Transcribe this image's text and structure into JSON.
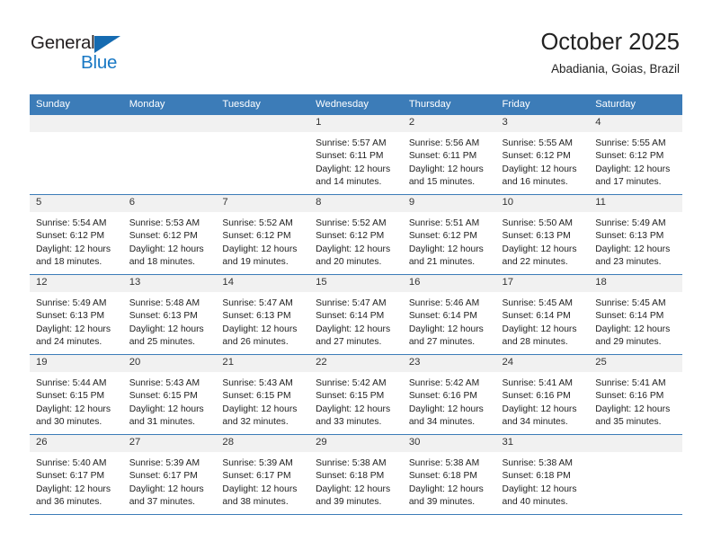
{
  "brand": {
    "name_top": "General",
    "name_bottom": "Blue",
    "triangle_color": "#156bb1",
    "blue_text_color": "#1878c4"
  },
  "header": {
    "title": "October 2025",
    "subtitle": "Abadiania, Goias, Brazil"
  },
  "theme": {
    "header_row_bg": "#3c7cb8",
    "header_row_text": "#ffffff",
    "daynum_bg": "#f1f1f1",
    "grid_line": "#3c7cb8"
  },
  "weekday_headers": [
    "Sunday",
    "Monday",
    "Tuesday",
    "Wednesday",
    "Thursday",
    "Friday",
    "Saturday"
  ],
  "labels": {
    "sunrise_prefix": "Sunrise:",
    "sunset_prefix": "Sunset:",
    "daylight_prefix": "Daylight:"
  },
  "weeks": [
    {
      "days": [
        {
          "day": "",
          "empty": true,
          "sunrise": "",
          "sunset": "",
          "daylight_line1": "",
          "daylight_line2": ""
        },
        {
          "day": "",
          "empty": true,
          "sunrise": "",
          "sunset": "",
          "daylight_line1": "",
          "daylight_line2": ""
        },
        {
          "day": "",
          "empty": true,
          "sunrise": "",
          "sunset": "",
          "daylight_line1": "",
          "daylight_line2": ""
        },
        {
          "day": "1",
          "empty": false,
          "sunrise": "Sunrise: 5:57 AM",
          "sunset": "Sunset: 6:11 PM",
          "daylight_line1": "Daylight: 12 hours",
          "daylight_line2": "and 14 minutes."
        },
        {
          "day": "2",
          "empty": false,
          "sunrise": "Sunrise: 5:56 AM",
          "sunset": "Sunset: 6:11 PM",
          "daylight_line1": "Daylight: 12 hours",
          "daylight_line2": "and 15 minutes."
        },
        {
          "day": "3",
          "empty": false,
          "sunrise": "Sunrise: 5:55 AM",
          "sunset": "Sunset: 6:12 PM",
          "daylight_line1": "Daylight: 12 hours",
          "daylight_line2": "and 16 minutes."
        },
        {
          "day": "4",
          "empty": false,
          "sunrise": "Sunrise: 5:55 AM",
          "sunset": "Sunset: 6:12 PM",
          "daylight_line1": "Daylight: 12 hours",
          "daylight_line2": "and 17 minutes."
        }
      ]
    },
    {
      "days": [
        {
          "day": "5",
          "empty": false,
          "sunrise": "Sunrise: 5:54 AM",
          "sunset": "Sunset: 6:12 PM",
          "daylight_line1": "Daylight: 12 hours",
          "daylight_line2": "and 18 minutes."
        },
        {
          "day": "6",
          "empty": false,
          "sunrise": "Sunrise: 5:53 AM",
          "sunset": "Sunset: 6:12 PM",
          "daylight_line1": "Daylight: 12 hours",
          "daylight_line2": "and 18 minutes."
        },
        {
          "day": "7",
          "empty": false,
          "sunrise": "Sunrise: 5:52 AM",
          "sunset": "Sunset: 6:12 PM",
          "daylight_line1": "Daylight: 12 hours",
          "daylight_line2": "and 19 minutes."
        },
        {
          "day": "8",
          "empty": false,
          "sunrise": "Sunrise: 5:52 AM",
          "sunset": "Sunset: 6:12 PM",
          "daylight_line1": "Daylight: 12 hours",
          "daylight_line2": "and 20 minutes."
        },
        {
          "day": "9",
          "empty": false,
          "sunrise": "Sunrise: 5:51 AM",
          "sunset": "Sunset: 6:12 PM",
          "daylight_line1": "Daylight: 12 hours",
          "daylight_line2": "and 21 minutes."
        },
        {
          "day": "10",
          "empty": false,
          "sunrise": "Sunrise: 5:50 AM",
          "sunset": "Sunset: 6:13 PM",
          "daylight_line1": "Daylight: 12 hours",
          "daylight_line2": "and 22 minutes."
        },
        {
          "day": "11",
          "empty": false,
          "sunrise": "Sunrise: 5:49 AM",
          "sunset": "Sunset: 6:13 PM",
          "daylight_line1": "Daylight: 12 hours",
          "daylight_line2": "and 23 minutes."
        }
      ]
    },
    {
      "days": [
        {
          "day": "12",
          "empty": false,
          "sunrise": "Sunrise: 5:49 AM",
          "sunset": "Sunset: 6:13 PM",
          "daylight_line1": "Daylight: 12 hours",
          "daylight_line2": "and 24 minutes."
        },
        {
          "day": "13",
          "empty": false,
          "sunrise": "Sunrise: 5:48 AM",
          "sunset": "Sunset: 6:13 PM",
          "daylight_line1": "Daylight: 12 hours",
          "daylight_line2": "and 25 minutes."
        },
        {
          "day": "14",
          "empty": false,
          "sunrise": "Sunrise: 5:47 AM",
          "sunset": "Sunset: 6:13 PM",
          "daylight_line1": "Daylight: 12 hours",
          "daylight_line2": "and 26 minutes."
        },
        {
          "day": "15",
          "empty": false,
          "sunrise": "Sunrise: 5:47 AM",
          "sunset": "Sunset: 6:14 PM",
          "daylight_line1": "Daylight: 12 hours",
          "daylight_line2": "and 27 minutes."
        },
        {
          "day": "16",
          "empty": false,
          "sunrise": "Sunrise: 5:46 AM",
          "sunset": "Sunset: 6:14 PM",
          "daylight_line1": "Daylight: 12 hours",
          "daylight_line2": "and 27 minutes."
        },
        {
          "day": "17",
          "empty": false,
          "sunrise": "Sunrise: 5:45 AM",
          "sunset": "Sunset: 6:14 PM",
          "daylight_line1": "Daylight: 12 hours",
          "daylight_line2": "and 28 minutes."
        },
        {
          "day": "18",
          "empty": false,
          "sunrise": "Sunrise: 5:45 AM",
          "sunset": "Sunset: 6:14 PM",
          "daylight_line1": "Daylight: 12 hours",
          "daylight_line2": "and 29 minutes."
        }
      ]
    },
    {
      "days": [
        {
          "day": "19",
          "empty": false,
          "sunrise": "Sunrise: 5:44 AM",
          "sunset": "Sunset: 6:15 PM",
          "daylight_line1": "Daylight: 12 hours",
          "daylight_line2": "and 30 minutes."
        },
        {
          "day": "20",
          "empty": false,
          "sunrise": "Sunrise: 5:43 AM",
          "sunset": "Sunset: 6:15 PM",
          "daylight_line1": "Daylight: 12 hours",
          "daylight_line2": "and 31 minutes."
        },
        {
          "day": "21",
          "empty": false,
          "sunrise": "Sunrise: 5:43 AM",
          "sunset": "Sunset: 6:15 PM",
          "daylight_line1": "Daylight: 12 hours",
          "daylight_line2": "and 32 minutes."
        },
        {
          "day": "22",
          "empty": false,
          "sunrise": "Sunrise: 5:42 AM",
          "sunset": "Sunset: 6:15 PM",
          "daylight_line1": "Daylight: 12 hours",
          "daylight_line2": "and 33 minutes."
        },
        {
          "day": "23",
          "empty": false,
          "sunrise": "Sunrise: 5:42 AM",
          "sunset": "Sunset: 6:16 PM",
          "daylight_line1": "Daylight: 12 hours",
          "daylight_line2": "and 34 minutes."
        },
        {
          "day": "24",
          "empty": false,
          "sunrise": "Sunrise: 5:41 AM",
          "sunset": "Sunset: 6:16 PM",
          "daylight_line1": "Daylight: 12 hours",
          "daylight_line2": "and 34 minutes."
        },
        {
          "day": "25",
          "empty": false,
          "sunrise": "Sunrise: 5:41 AM",
          "sunset": "Sunset: 6:16 PM",
          "daylight_line1": "Daylight: 12 hours",
          "daylight_line2": "and 35 minutes."
        }
      ]
    },
    {
      "days": [
        {
          "day": "26",
          "empty": false,
          "sunrise": "Sunrise: 5:40 AM",
          "sunset": "Sunset: 6:17 PM",
          "daylight_line1": "Daylight: 12 hours",
          "daylight_line2": "and 36 minutes."
        },
        {
          "day": "27",
          "empty": false,
          "sunrise": "Sunrise: 5:39 AM",
          "sunset": "Sunset: 6:17 PM",
          "daylight_line1": "Daylight: 12 hours",
          "daylight_line2": "and 37 minutes."
        },
        {
          "day": "28",
          "empty": false,
          "sunrise": "Sunrise: 5:39 AM",
          "sunset": "Sunset: 6:17 PM",
          "daylight_line1": "Daylight: 12 hours",
          "daylight_line2": "and 38 minutes."
        },
        {
          "day": "29",
          "empty": false,
          "sunrise": "Sunrise: 5:38 AM",
          "sunset": "Sunset: 6:18 PM",
          "daylight_line1": "Daylight: 12 hours",
          "daylight_line2": "and 39 minutes."
        },
        {
          "day": "30",
          "empty": false,
          "sunrise": "Sunrise: 5:38 AM",
          "sunset": "Sunset: 6:18 PM",
          "daylight_line1": "Daylight: 12 hours",
          "daylight_line2": "and 39 minutes."
        },
        {
          "day": "31",
          "empty": false,
          "sunrise": "Sunrise: 5:38 AM",
          "sunset": "Sunset: 6:18 PM",
          "daylight_line1": "Daylight: 12 hours",
          "daylight_line2": "and 40 minutes."
        },
        {
          "day": "",
          "empty": true,
          "sunrise": "",
          "sunset": "",
          "daylight_line1": "",
          "daylight_line2": ""
        }
      ]
    }
  ]
}
